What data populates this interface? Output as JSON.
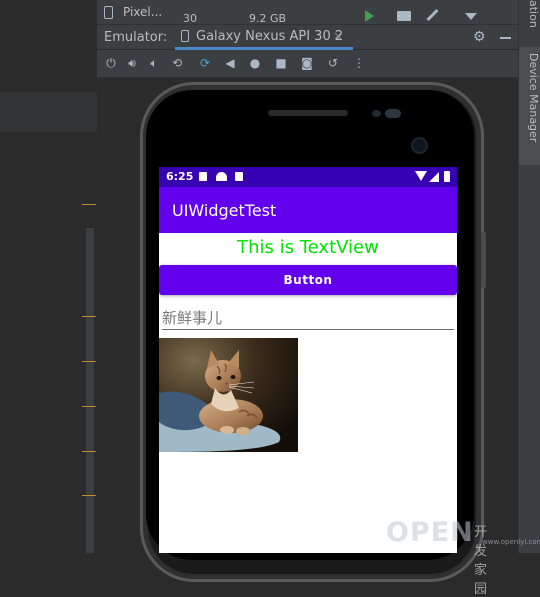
{
  "ide": {
    "device_row": {
      "name": "Pixel...",
      "api": "30",
      "size": "9.2 GB"
    },
    "tab_bar": {
      "label": "Emulator:",
      "tab_title": "Galaxy Nexus API 30 2",
      "close": "×"
    },
    "side_panel": {
      "top_text": "ation",
      "device_manager": "Device Manager"
    }
  },
  "toolbar_icons": [
    "power-icon",
    "volume-up-icon",
    "volume-down-icon",
    "rotate-left-icon",
    "rotate-right-icon",
    "back-icon",
    "home-icon",
    "overview-icon",
    "camera-icon",
    "replay-icon",
    "more-icon"
  ],
  "phone": {
    "status_bar": {
      "time": "6:25"
    },
    "app_bar": {
      "title": "UIWidgetTest"
    },
    "text_view": {
      "text": "This is TextView",
      "color": "#00e400"
    },
    "button": {
      "label": "Button"
    },
    "edit_text": {
      "hint": "新鲜事儿"
    },
    "image": {
      "subject": "kitten-on-pillow"
    }
  },
  "watermark": {
    "brand": "OPEN",
    "cn": "开发家园",
    "url": "www.openlyi.com"
  },
  "colors": {
    "primary": "#6200ee",
    "primary_dark": "#3700b3",
    "ide_bg": "#2b2b2b",
    "ide_panel": "#3c3f41",
    "tab_accent": "#4a88c7"
  }
}
